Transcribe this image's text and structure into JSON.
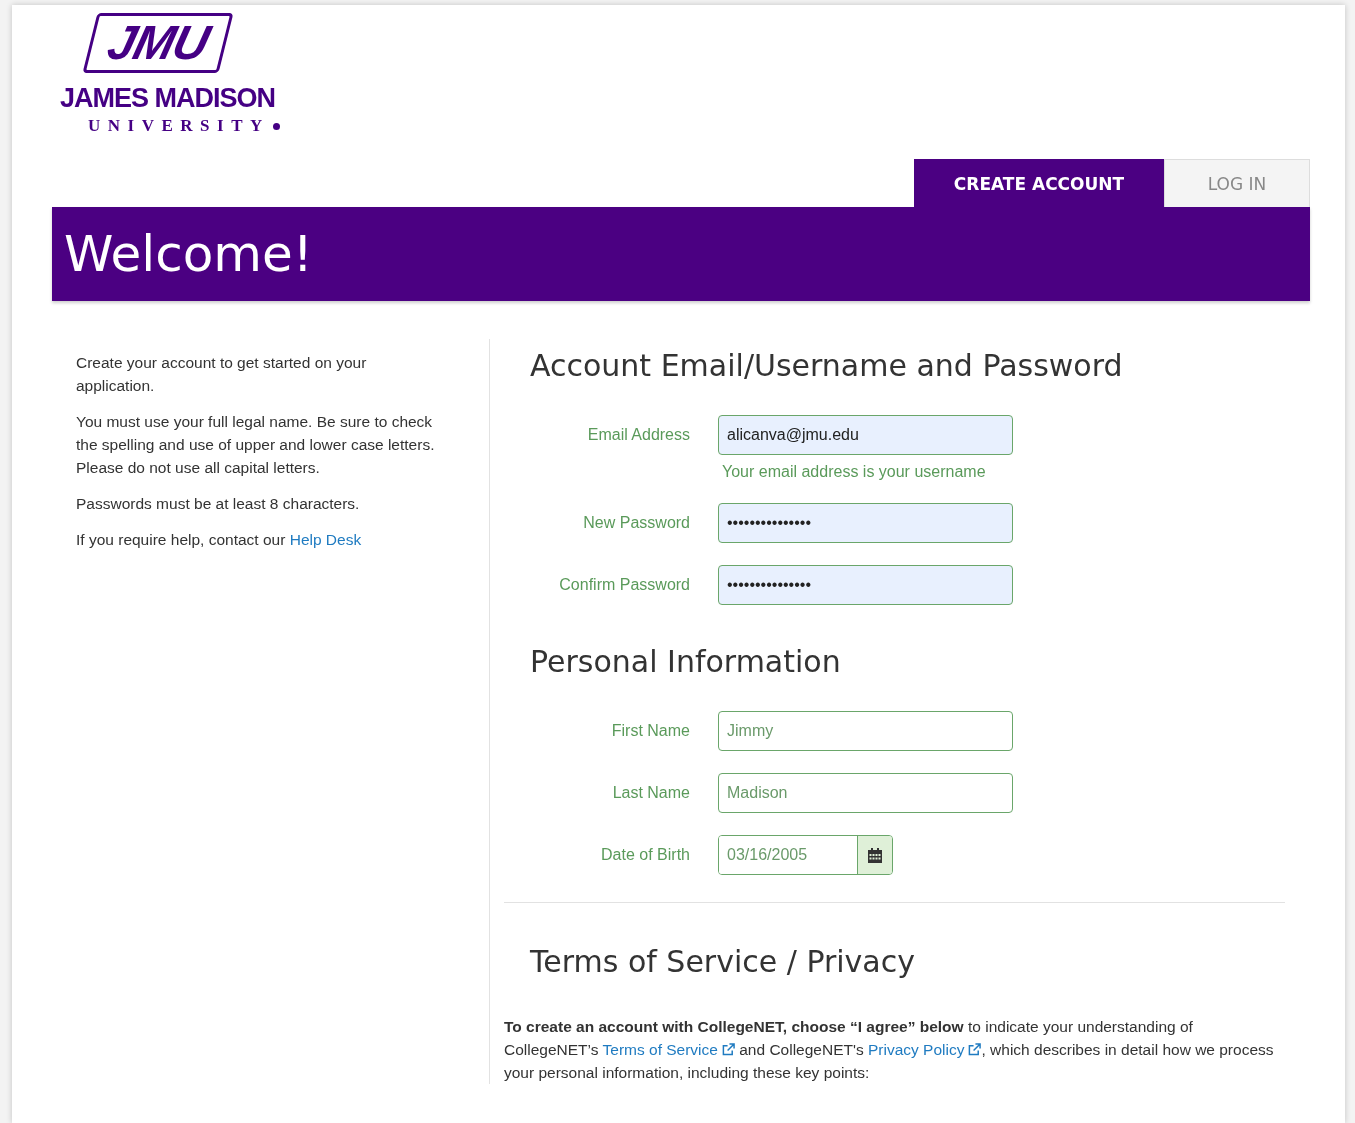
{
  "logo": {
    "mark": "JMU",
    "name": "JAMES MADISON",
    "sub": "UNIVERSITY"
  },
  "tabs": [
    {
      "label": "CREATE ACCOUNT",
      "selected": true
    },
    {
      "label": "LOG IN",
      "selected": false
    }
  ],
  "banner": {
    "title": "Welcome!"
  },
  "sidebar": {
    "paragraphs": [
      "Create your account to get started on your application.",
      "You must use your full legal name. Be sure to check the spelling and use of upper and lower case letters. Please do not use all capital letters.",
      "Passwords must be at least 8 characters."
    ],
    "help_text": "If you require help, contact our ",
    "help_link": "Help Desk"
  },
  "sections": [
    {
      "title": "Account Email/Username and Password",
      "fields": [
        {
          "kind": "text",
          "label": "Email Address",
          "value": "alicanva@jmu.edu",
          "hint": "Your email address is your username",
          "filled": true
        },
        {
          "kind": "text",
          "label": "New Password",
          "value": "•••••••••••••••",
          "filled": true
        },
        {
          "kind": "text",
          "label": "Confirm Password",
          "value": "•••••••••••••••",
          "filled": true
        }
      ]
    },
    {
      "title": "Personal Information",
      "fields": [
        {
          "kind": "text",
          "label": "First Name",
          "value": "Jimmy",
          "filled": false
        },
        {
          "kind": "text",
          "label": "Last Name",
          "value": "Madison",
          "filled": false
        },
        {
          "kind": "date",
          "label": "Date of Birth",
          "value": "03/16/2005",
          "filled": false
        }
      ]
    }
  ],
  "terms": {
    "title": "Terms of Service / Privacy",
    "segments": [
      {
        "kind": "bold",
        "text": "To create an account with CollegeNET, choose “I agree” below"
      },
      {
        "kind": "text",
        "text": " to indicate your understanding of CollegeNET’s "
      },
      {
        "kind": "link",
        "text": "Terms of Service"
      },
      {
        "kind": "text",
        "text": " and CollegeNET's "
      },
      {
        "kind": "link",
        "text": "Privacy Policy"
      },
      {
        "kind": "text",
        "text": ", which describes in detail how we process your personal information, including these key points:"
      }
    ]
  }
}
